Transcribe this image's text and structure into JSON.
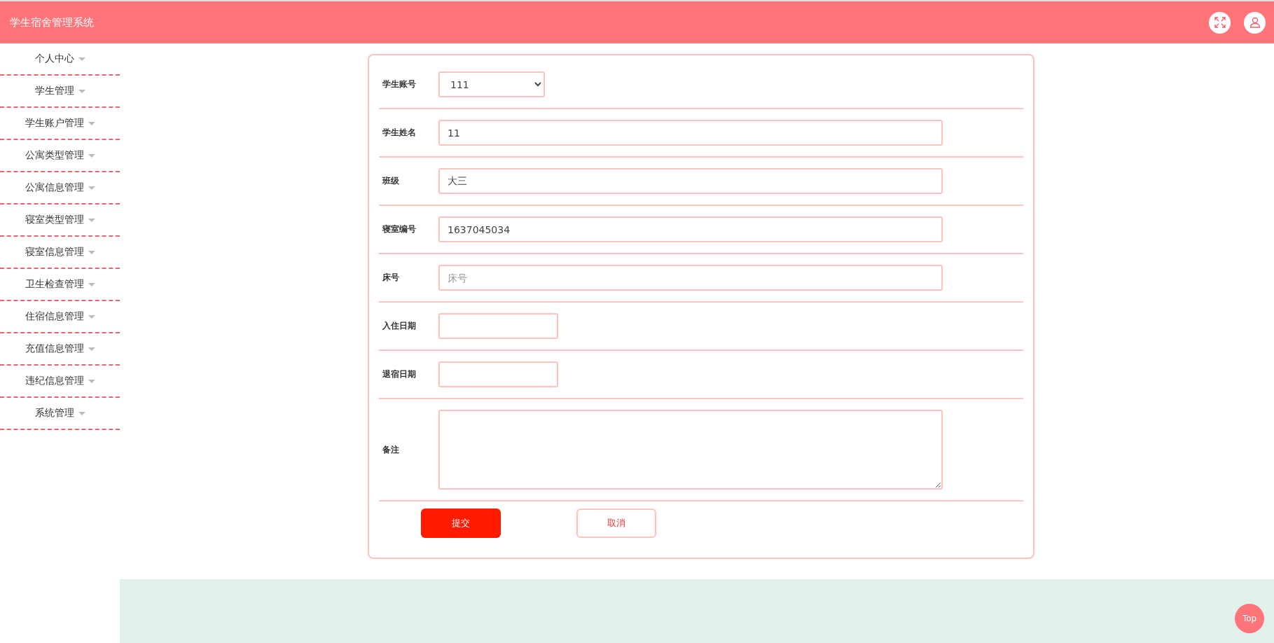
{
  "header": {
    "title": "学生宿舍管理系统"
  },
  "sidebar": {
    "items": [
      {
        "label": "个人中心",
        "expanded": false
      },
      {
        "label": "学生管理",
        "expanded": false
      },
      {
        "label": "学生账户管理",
        "expanded": false
      },
      {
        "label": "公寓类型管理",
        "expanded": false
      },
      {
        "label": "公寓信息管理",
        "expanded": false
      },
      {
        "label": "寝室类型管理",
        "expanded": false
      },
      {
        "label": "寝室信息管理",
        "expanded": false
      },
      {
        "label": "卫生检查管理",
        "expanded": false
      },
      {
        "label": "住宿信息管理",
        "expanded": false
      },
      {
        "label": "充值信息管理",
        "expanded": false
      },
      {
        "label": "违纪信息管理",
        "expanded": false
      },
      {
        "label": "系统管理",
        "expanded": false
      }
    ]
  },
  "form": {
    "fields": [
      {
        "kind": "select",
        "label": "学生账号",
        "value": "111"
      },
      {
        "kind": "text",
        "label": "学生姓名",
        "value": "11"
      },
      {
        "kind": "text",
        "label": "班级",
        "value": "大三"
      },
      {
        "kind": "text",
        "label": "寝室编号",
        "value": "1637045034"
      },
      {
        "kind": "text",
        "label": "床号",
        "placeholder": "床号"
      },
      {
        "kind": "date",
        "label": "入住日期"
      },
      {
        "kind": "date",
        "label": "退宿日期"
      },
      {
        "kind": "textarea",
        "label": "备注"
      }
    ],
    "buttons": [
      {
        "kind": "primary",
        "label": "提交"
      },
      {
        "kind": "secondary",
        "label": "取消"
      }
    ]
  },
  "back_to_top": {
    "label": "Top"
  }
}
